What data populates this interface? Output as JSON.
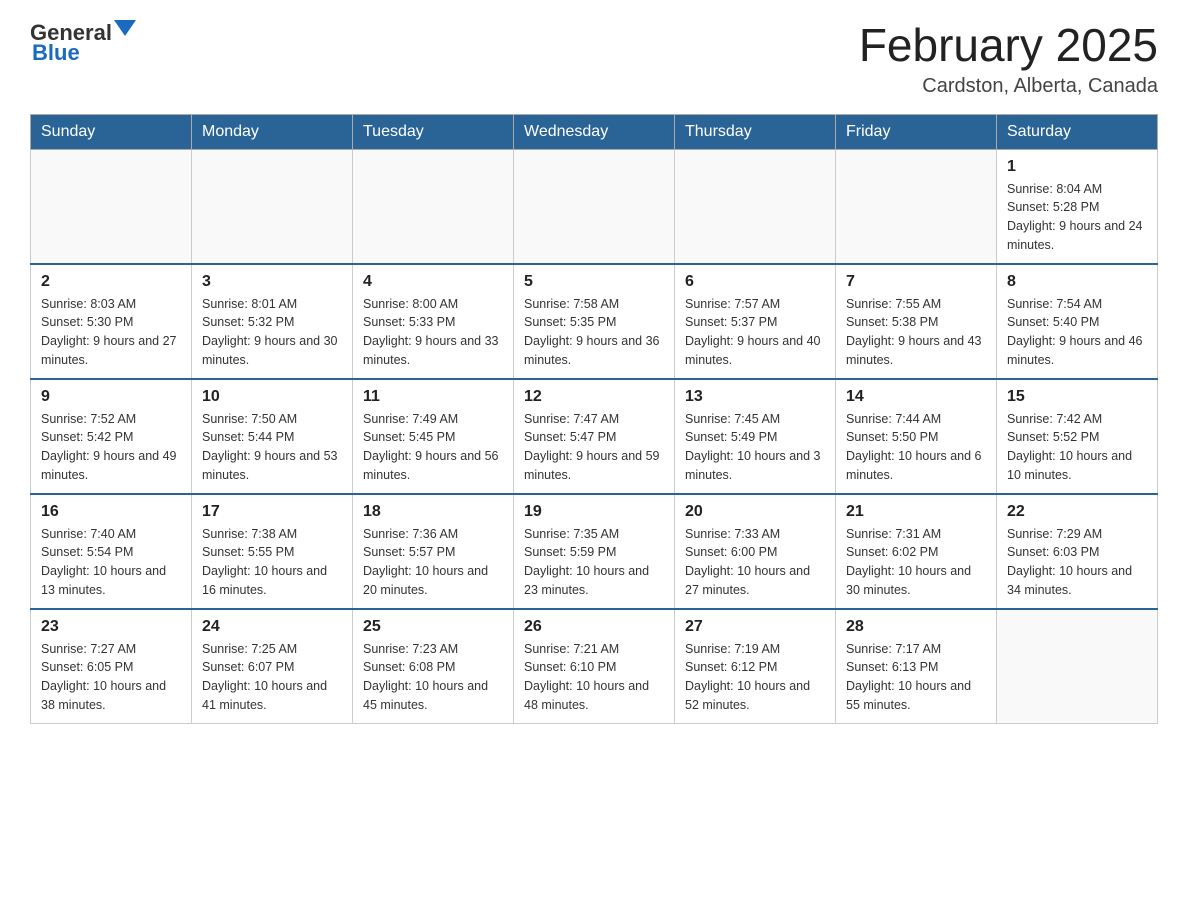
{
  "header": {
    "title": "February 2025",
    "subtitle": "Cardston, Alberta, Canada",
    "logo_general": "General",
    "logo_blue": "Blue"
  },
  "weekdays": [
    "Sunday",
    "Monday",
    "Tuesday",
    "Wednesday",
    "Thursday",
    "Friday",
    "Saturday"
  ],
  "weeks": [
    [
      {
        "day": "",
        "info": ""
      },
      {
        "day": "",
        "info": ""
      },
      {
        "day": "",
        "info": ""
      },
      {
        "day": "",
        "info": ""
      },
      {
        "day": "",
        "info": ""
      },
      {
        "day": "",
        "info": ""
      },
      {
        "day": "1",
        "info": "Sunrise: 8:04 AM\nSunset: 5:28 PM\nDaylight: 9 hours and 24 minutes."
      }
    ],
    [
      {
        "day": "2",
        "info": "Sunrise: 8:03 AM\nSunset: 5:30 PM\nDaylight: 9 hours and 27 minutes."
      },
      {
        "day": "3",
        "info": "Sunrise: 8:01 AM\nSunset: 5:32 PM\nDaylight: 9 hours and 30 minutes."
      },
      {
        "day": "4",
        "info": "Sunrise: 8:00 AM\nSunset: 5:33 PM\nDaylight: 9 hours and 33 minutes."
      },
      {
        "day": "5",
        "info": "Sunrise: 7:58 AM\nSunset: 5:35 PM\nDaylight: 9 hours and 36 minutes."
      },
      {
        "day": "6",
        "info": "Sunrise: 7:57 AM\nSunset: 5:37 PM\nDaylight: 9 hours and 40 minutes."
      },
      {
        "day": "7",
        "info": "Sunrise: 7:55 AM\nSunset: 5:38 PM\nDaylight: 9 hours and 43 minutes."
      },
      {
        "day": "8",
        "info": "Sunrise: 7:54 AM\nSunset: 5:40 PM\nDaylight: 9 hours and 46 minutes."
      }
    ],
    [
      {
        "day": "9",
        "info": "Sunrise: 7:52 AM\nSunset: 5:42 PM\nDaylight: 9 hours and 49 minutes."
      },
      {
        "day": "10",
        "info": "Sunrise: 7:50 AM\nSunset: 5:44 PM\nDaylight: 9 hours and 53 minutes."
      },
      {
        "day": "11",
        "info": "Sunrise: 7:49 AM\nSunset: 5:45 PM\nDaylight: 9 hours and 56 minutes."
      },
      {
        "day": "12",
        "info": "Sunrise: 7:47 AM\nSunset: 5:47 PM\nDaylight: 9 hours and 59 minutes."
      },
      {
        "day": "13",
        "info": "Sunrise: 7:45 AM\nSunset: 5:49 PM\nDaylight: 10 hours and 3 minutes."
      },
      {
        "day": "14",
        "info": "Sunrise: 7:44 AM\nSunset: 5:50 PM\nDaylight: 10 hours and 6 minutes."
      },
      {
        "day": "15",
        "info": "Sunrise: 7:42 AM\nSunset: 5:52 PM\nDaylight: 10 hours and 10 minutes."
      }
    ],
    [
      {
        "day": "16",
        "info": "Sunrise: 7:40 AM\nSunset: 5:54 PM\nDaylight: 10 hours and 13 minutes."
      },
      {
        "day": "17",
        "info": "Sunrise: 7:38 AM\nSunset: 5:55 PM\nDaylight: 10 hours and 16 minutes."
      },
      {
        "day": "18",
        "info": "Sunrise: 7:36 AM\nSunset: 5:57 PM\nDaylight: 10 hours and 20 minutes."
      },
      {
        "day": "19",
        "info": "Sunrise: 7:35 AM\nSunset: 5:59 PM\nDaylight: 10 hours and 23 minutes."
      },
      {
        "day": "20",
        "info": "Sunrise: 7:33 AM\nSunset: 6:00 PM\nDaylight: 10 hours and 27 minutes."
      },
      {
        "day": "21",
        "info": "Sunrise: 7:31 AM\nSunset: 6:02 PM\nDaylight: 10 hours and 30 minutes."
      },
      {
        "day": "22",
        "info": "Sunrise: 7:29 AM\nSunset: 6:03 PM\nDaylight: 10 hours and 34 minutes."
      }
    ],
    [
      {
        "day": "23",
        "info": "Sunrise: 7:27 AM\nSunset: 6:05 PM\nDaylight: 10 hours and 38 minutes."
      },
      {
        "day": "24",
        "info": "Sunrise: 7:25 AM\nSunset: 6:07 PM\nDaylight: 10 hours and 41 minutes."
      },
      {
        "day": "25",
        "info": "Sunrise: 7:23 AM\nSunset: 6:08 PM\nDaylight: 10 hours and 45 minutes."
      },
      {
        "day": "26",
        "info": "Sunrise: 7:21 AM\nSunset: 6:10 PM\nDaylight: 10 hours and 48 minutes."
      },
      {
        "day": "27",
        "info": "Sunrise: 7:19 AM\nSunset: 6:12 PM\nDaylight: 10 hours and 52 minutes."
      },
      {
        "day": "28",
        "info": "Sunrise: 7:17 AM\nSunset: 6:13 PM\nDaylight: 10 hours and 55 minutes."
      },
      {
        "day": "",
        "info": ""
      }
    ]
  ]
}
